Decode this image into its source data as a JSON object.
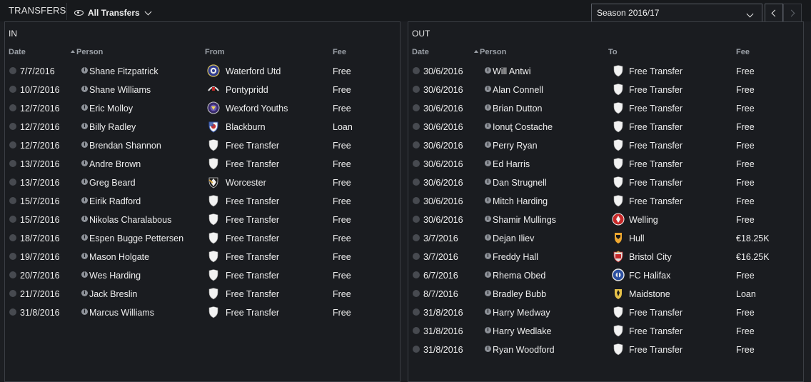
{
  "header": {
    "title": "TRANSFERS",
    "view_label": "All Transfers",
    "season_label": "Season 2016/17"
  },
  "columns": {
    "date": "Date",
    "person": "Person",
    "from": "From",
    "to": "To",
    "fee": "Fee"
  },
  "icons": {
    "view": "eye-icon",
    "dropdown": "chevron-down-icon",
    "prev": "chevron-left-icon",
    "next": "chevron-right-icon",
    "status": "check-circle-icon",
    "info": "info-icon",
    "free_transfer": "shield-icon"
  },
  "colors": {
    "background": "#1c1e22",
    "panel": "#1a1c20",
    "text": "#eeeeee",
    "header_text": "#9ba0a7"
  },
  "in": {
    "title": "IN",
    "rows": [
      {
        "date": "7/7/2016",
        "person": "Shane Fitzpatrick",
        "club": "Waterford Utd",
        "fee": "Free",
        "crest": "waterford"
      },
      {
        "date": "10/7/2016",
        "person": "Shane Williams",
        "club": "Pontypridd",
        "fee": "Free",
        "crest": "pontypridd"
      },
      {
        "date": "12/7/2016",
        "person": "Eric Molloy",
        "club": "Wexford Youths",
        "fee": "Free",
        "crest": "wexford"
      },
      {
        "date": "12/7/2016",
        "person": "Billy Radley",
        "club": "Blackburn",
        "fee": "Loan",
        "crest": "blackburn"
      },
      {
        "date": "12/7/2016",
        "person": "Brendan Shannon",
        "club": "Free Transfer",
        "fee": "Free",
        "crest": "shield"
      },
      {
        "date": "13/7/2016",
        "person": "Andre Brown",
        "club": "Free Transfer",
        "fee": "Free",
        "crest": "shield"
      },
      {
        "date": "13/7/2016",
        "person": "Greg Beard",
        "club": "Worcester",
        "fee": "Free",
        "crest": "worcester"
      },
      {
        "date": "15/7/2016",
        "person": "Eirik Radford",
        "club": "Free Transfer",
        "fee": "Free",
        "crest": "shield"
      },
      {
        "date": "15/7/2016",
        "person": "Nikolas Charalabous",
        "club": "Free Transfer",
        "fee": "Free",
        "crest": "shield"
      },
      {
        "date": "18/7/2016",
        "person": "Espen Bugge Pettersen",
        "club": "Free Transfer",
        "fee": "Free",
        "crest": "shield"
      },
      {
        "date": "19/7/2016",
        "person": "Mason Holgate",
        "club": "Free Transfer",
        "fee": "Free",
        "crest": "shield"
      },
      {
        "date": "20/7/2016",
        "person": "Wes Harding",
        "club": "Free Transfer",
        "fee": "Free",
        "crest": "shield"
      },
      {
        "date": "21/7/2016",
        "person": "Jack Breslin",
        "club": "Free Transfer",
        "fee": "Free",
        "crest": "shield"
      },
      {
        "date": "31/8/2016",
        "person": "Marcus Williams",
        "club": "Free Transfer",
        "fee": "Free",
        "crest": "shield"
      }
    ]
  },
  "out": {
    "title": "OUT",
    "rows": [
      {
        "date": "30/6/2016",
        "person": "Will Antwi",
        "club": "Free Transfer",
        "fee": "Free",
        "crest": "shield"
      },
      {
        "date": "30/6/2016",
        "person": "Alan Connell",
        "club": "Free Transfer",
        "fee": "Free",
        "crest": "shield"
      },
      {
        "date": "30/6/2016",
        "person": "Brian Dutton",
        "club": "Free Transfer",
        "fee": "Free",
        "crest": "shield"
      },
      {
        "date": "30/6/2016",
        "person": "Ionuţ Costache",
        "club": "Free Transfer",
        "fee": "Free",
        "crest": "shield"
      },
      {
        "date": "30/6/2016",
        "person": "Perry Ryan",
        "club": "Free Transfer",
        "fee": "Free",
        "crest": "shield"
      },
      {
        "date": "30/6/2016",
        "person": "Ed Harris",
        "club": "Free Transfer",
        "fee": "Free",
        "crest": "shield"
      },
      {
        "date": "30/6/2016",
        "person": "Dan Strugnell",
        "club": "Free Transfer",
        "fee": "Free",
        "crest": "shield"
      },
      {
        "date": "30/6/2016",
        "person": "Mitch Harding",
        "club": "Free Transfer",
        "fee": "Free",
        "crest": "shield"
      },
      {
        "date": "30/6/2016",
        "person": "Shamir Mullings",
        "club": "Welling",
        "fee": "Free",
        "crest": "welling"
      },
      {
        "date": "3/7/2016",
        "person": "Dejan Iliev",
        "club": "Hull",
        "fee": "€18.25K",
        "crest": "hull"
      },
      {
        "date": "3/7/2016",
        "person": "Freddy Hall",
        "club": "Bristol City",
        "fee": "€16.25K",
        "crest": "bristol"
      },
      {
        "date": "6/7/2016",
        "person": "Rhema Obed",
        "club": "FC Halifax",
        "fee": "Free",
        "crest": "halifax"
      },
      {
        "date": "8/7/2016",
        "person": "Bradley Bubb",
        "club": "Maidstone",
        "fee": "Loan",
        "crest": "maidstone"
      },
      {
        "date": "31/8/2016",
        "person": "Harry Medway",
        "club": "Free Transfer",
        "fee": "Free",
        "crest": "shield"
      },
      {
        "date": "31/8/2016",
        "person": "Harry Wedlake",
        "club": "Free Transfer",
        "fee": "Free",
        "crest": "shield"
      },
      {
        "date": "31/8/2016",
        "person": "Ryan Woodford",
        "club": "Free Transfer",
        "fee": "Free",
        "crest": "shield"
      }
    ]
  }
}
